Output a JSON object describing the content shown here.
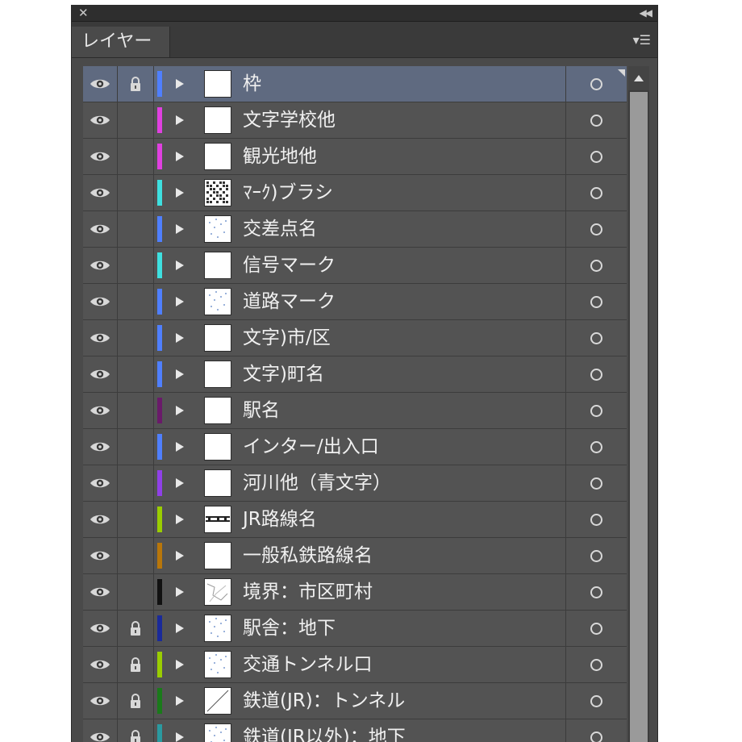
{
  "panel": {
    "tab_label": "レイヤー",
    "close_icon": "close-icon",
    "collapse_icon": "double-chevron-left-icon",
    "menu_icon": "panel-menu-icon"
  },
  "layers": [
    {
      "name": "枠",
      "locked": true,
      "color": "#4f7fff",
      "selected": true,
      "thumb": "blank"
    },
    {
      "name": "文字学校他",
      "locked": false,
      "color": "#e040e0",
      "selected": false,
      "thumb": "blank"
    },
    {
      "name": "観光地他",
      "locked": false,
      "color": "#e040e0",
      "selected": false,
      "thumb": "blank"
    },
    {
      "name": "ﾏｰｸ)ブラシ",
      "locked": false,
      "color": "#3ee0e0",
      "selected": false,
      "thumb": "pattern"
    },
    {
      "name": "交差点名",
      "locked": false,
      "color": "#4f7fff",
      "selected": false,
      "thumb": "dots"
    },
    {
      "name": "信号マーク",
      "locked": false,
      "color": "#3ee0e0",
      "selected": false,
      "thumb": "blank"
    },
    {
      "name": "道路マーク",
      "locked": false,
      "color": "#4f7fff",
      "selected": false,
      "thumb": "dots"
    },
    {
      "name": "文字)市/区",
      "locked": false,
      "color": "#4f7fff",
      "selected": false,
      "thumb": "blank"
    },
    {
      "name": "文字)町名",
      "locked": false,
      "color": "#4f7fff",
      "selected": false,
      "thumb": "blank"
    },
    {
      "name": "駅名",
      "locked": false,
      "color": "#6a1a6a",
      "selected": false,
      "thumb": "blank"
    },
    {
      "name": "インター/出入口",
      "locked": false,
      "color": "#4f7fff",
      "selected": false,
      "thumb": "blank"
    },
    {
      "name": "河川他（青文字）",
      "locked": false,
      "color": "#9040e8",
      "selected": false,
      "thumb": "blank"
    },
    {
      "name": "JR路線名",
      "locked": false,
      "color": "#9acd00",
      "selected": false,
      "thumb": "bars"
    },
    {
      "name": "一般私鉄路線名",
      "locked": false,
      "color": "#b8760a",
      "selected": false,
      "thumb": "blank"
    },
    {
      "name": "境界：市区町村",
      "locked": false,
      "color": "#111111",
      "selected": false,
      "thumb": "lines"
    },
    {
      "name": "駅舎：地下",
      "locked": true,
      "color": "#1a2a9a",
      "selected": false,
      "thumb": "dots"
    },
    {
      "name": "交通トンネル口",
      "locked": true,
      "color": "#9acd00",
      "selected": false,
      "thumb": "dots"
    },
    {
      "name": "鉄道(JR)：トンネル",
      "locked": true,
      "color": "#1a7a1a",
      "selected": false,
      "thumb": "diagonal"
    },
    {
      "name": "鉄道(JR以外)：地下",
      "locked": true,
      "color": "#2a9aa0",
      "selected": false,
      "thumb": "dots"
    }
  ],
  "icons": {
    "eye": "eye-icon",
    "lock": "lock-icon",
    "expand": "triangle-right-icon",
    "target": "target-circle-icon",
    "scroll_up": "scroll-up-arrow-icon"
  }
}
